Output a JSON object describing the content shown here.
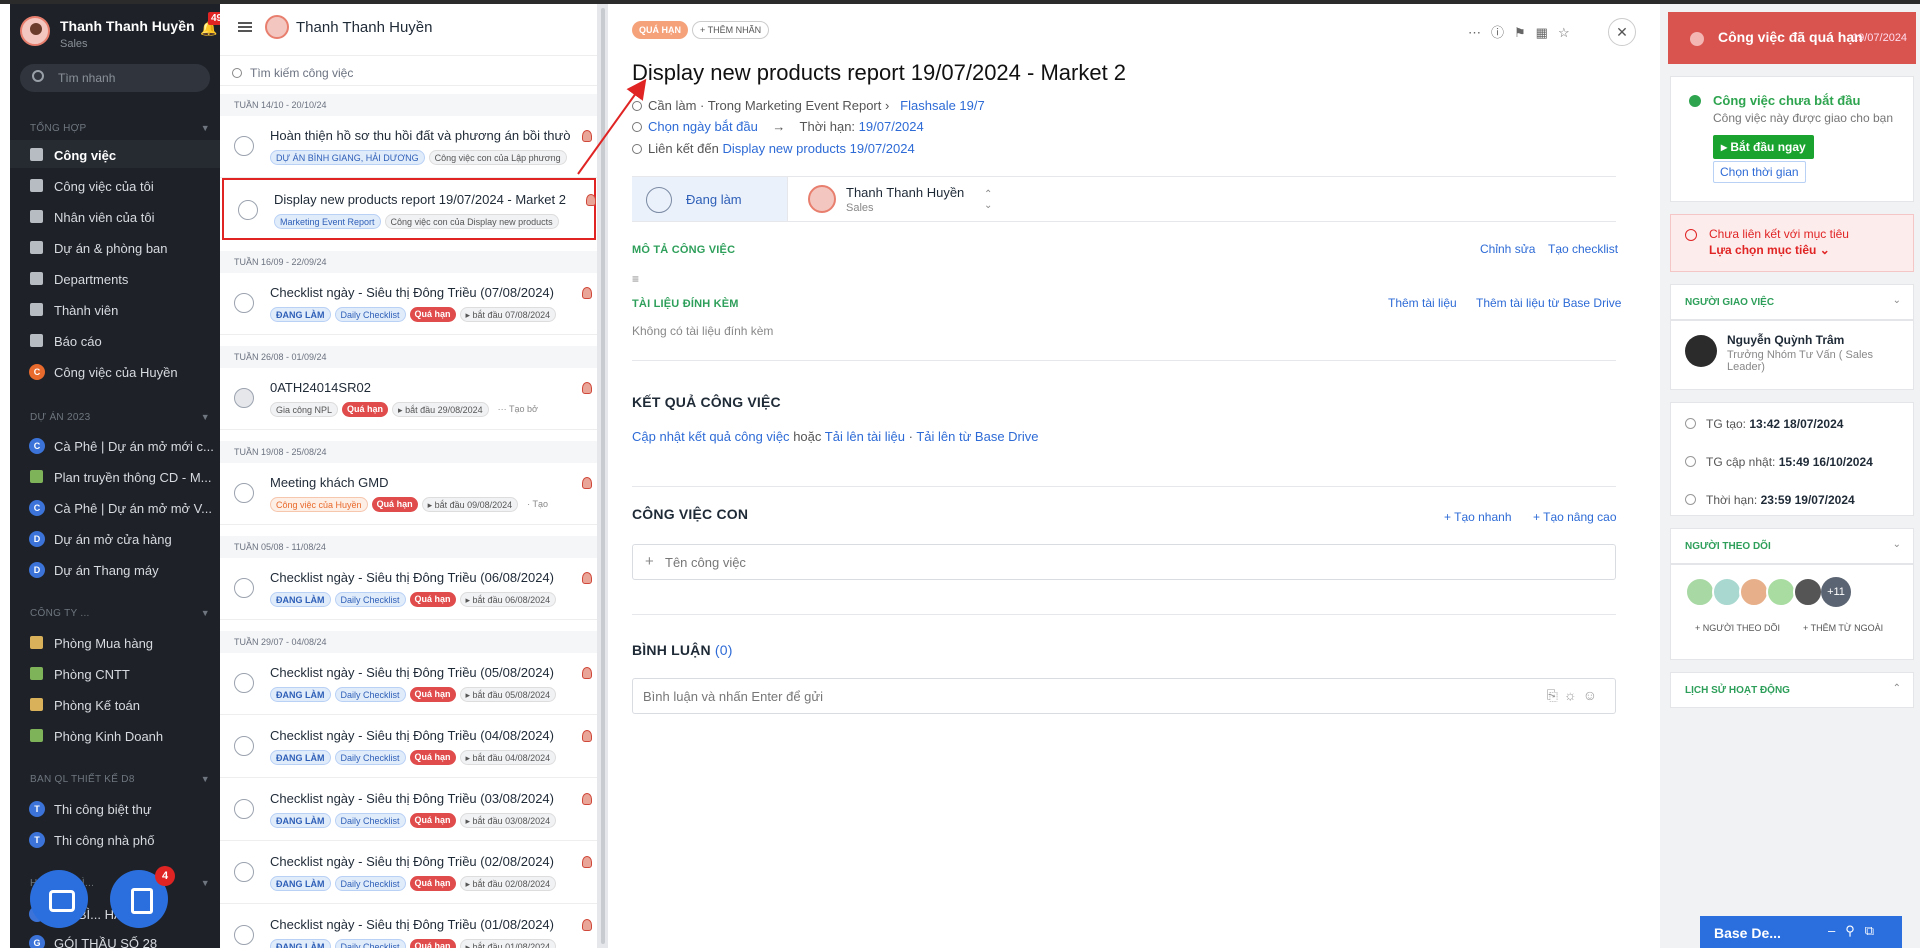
{
  "sidebar": {
    "user_name": "Thanh Thanh Huyền",
    "user_role": "Sales",
    "notif_count": "49",
    "search_placeholder": "Tìm nhanh",
    "sec1": "TỔNG HỢP",
    "items1": [
      "Công việc",
      "Công việc của tôi",
      "Nhân viên của tôi",
      "Dự án & phòng ban",
      "Departments",
      "Thành viên",
      "Báo cáo",
      "Công việc của Huyền"
    ],
    "item_huyen_letter": "C",
    "sec2": "DỰ ÁN 2023",
    "items2": [
      {
        "letter": "C",
        "label": "Cà Phê | Dự án mở mới c..."
      },
      {
        "letter": "",
        "label": "Plan truyền thông CD - M..."
      },
      {
        "letter": "C",
        "label": "Cà Phê | Dự án mở mở V..."
      },
      {
        "letter": "D",
        "label": "Dự án mở cửa hàng"
      },
      {
        "letter": "D",
        "label": "Dự án Thang máy"
      }
    ],
    "sec3": "CÔNG TY ...",
    "items3": [
      "Phòng Mua hàng",
      "Phòng CNTT",
      "Phòng Kế toán",
      "Phòng Kinh Doanh"
    ],
    "sec4": "BAN QL THIẾT KẾ D8",
    "items4": [
      {
        "letter": "T",
        "label": "Thi công biệt thự"
      },
      {
        "letter": "T",
        "label": "Thi công nhà phố"
      }
    ],
    "sec5": "H... HOA BÌ...",
    "items5": [
      {
        "letter": "",
        "label": "...N BÌ... HẢI ..."
      },
      {
        "letter": "G",
        "label": "GÓI THẦU SỐ 28"
      }
    ],
    "fab_badge": "4"
  },
  "list": {
    "header_name": "Thanh Thanh Huyền",
    "search_placeholder": "Tìm kiếm công việc",
    "weeks": [
      "TUẦN 14/10 - 20/10/24",
      "TUẦN 16/09 - 22/09/24",
      "TUẦN 26/08 - 01/09/24",
      "TUẦN 19/08 - 25/08/24",
      "TUẦN 05/08 - 11/08/24",
      "TUẦN 29/07 - 04/08/24"
    ],
    "tasks": [
      {
        "title": "Hoàn thiện hồ sơ thu hồi đất và phương án bồi thườ",
        "tags": [
          [
            "blue",
            "DỰ ÁN BÌNH GIANG, HẢI DƯƠNG"
          ],
          [
            "gray",
            "Công việc con của Lập phương"
          ]
        ]
      },
      {
        "title": "Display new products report 19/07/2024 - Market 2",
        "tags": [
          [
            "blue",
            "Marketing Event Report"
          ],
          [
            "gray",
            "Công việc con của Display new products"
          ]
        ]
      },
      {
        "title": "Checklist ngày - Siêu thị Đông Triều (07/08/2024)",
        "tags": [
          [
            "blue bold",
            "ĐANG LÀM"
          ],
          [
            "blue",
            "Daily Checklist"
          ],
          [
            "red",
            "Quá hạn"
          ],
          [
            "gray",
            "▸ bắt đầu 07/08/2024"
          ]
        ]
      },
      {
        "title": "0ATH24014SR02",
        "tags": [
          [
            "gray",
            "Gia công NPL"
          ],
          [
            "red",
            "Quá hạn"
          ],
          [
            "gray",
            "▸ bắt đầu 29/08/2024"
          ],
          [
            "plain",
            "··· Tạo bở"
          ]
        ]
      },
      {
        "title": "Meeting khách GMD",
        "tags": [
          [
            "orange",
            "Công việc của Huyền"
          ],
          [
            "red",
            "Quá hạn"
          ],
          [
            "gray",
            "▸ bắt đầu 09/08/2024"
          ],
          [
            "plain",
            "· Tạo"
          ]
        ]
      },
      {
        "title": "Checklist ngày - Siêu thị Đông Triều (06/08/2024)",
        "tags": [
          [
            "blue bold",
            "ĐANG LÀM"
          ],
          [
            "blue",
            "Daily Checklist"
          ],
          [
            "red",
            "Quá hạn"
          ],
          [
            "gray",
            "▸ bắt đầu 06/08/2024"
          ]
        ]
      },
      {
        "title": "Checklist ngày - Siêu thị Đông Triều (05/08/2024)",
        "tags": [
          [
            "blue bold",
            "ĐANG LÀM"
          ],
          [
            "blue",
            "Daily Checklist"
          ],
          [
            "red",
            "Quá hạn"
          ],
          [
            "gray",
            "▸ bắt đầu 05/08/2024"
          ]
        ]
      },
      {
        "title": "Checklist ngày - Siêu thị Đông Triều (04/08/2024)",
        "tags": [
          [
            "blue bold",
            "ĐANG LÀM"
          ],
          [
            "blue",
            "Daily Checklist"
          ],
          [
            "red",
            "Quá hạn"
          ],
          [
            "gray",
            "▸ bắt đầu 04/08/2024"
          ]
        ]
      },
      {
        "title": "Checklist ngày - Siêu thị Đông Triều (03/08/2024)",
        "tags": [
          [
            "blue bold",
            "ĐANG LÀM"
          ],
          [
            "blue",
            "Daily Checklist"
          ],
          [
            "red",
            "Quá hạn"
          ],
          [
            "gray",
            "▸ bắt đầu 03/08/2024"
          ]
        ]
      },
      {
        "title": "Checklist ngày - Siêu thị Đông Triều (02/08/2024)",
        "tags": [
          [
            "blue bold",
            "ĐANG LÀM"
          ],
          [
            "blue",
            "Daily Checklist"
          ],
          [
            "red",
            "Quá hạn"
          ],
          [
            "gray",
            "▸ bắt đầu 02/08/2024"
          ]
        ]
      },
      {
        "title": "Checklist ngày - Siêu thị Đông Triều (01/08/2024)",
        "tags": [
          [
            "blue bold",
            "ĐANG LÀM"
          ],
          [
            "blue",
            "Daily Checklist"
          ],
          [
            "red",
            "Quá hạn"
          ],
          [
            "gray",
            "▸ bắt đầu 01/08/2024"
          ]
        ]
      }
    ]
  },
  "detail": {
    "badge": "QUÁ HẠN",
    "add_label": "+ THÊM NHÃN",
    "title": "Display new products report 19/07/2024 - Market 2",
    "meta1_prefix": "Cần làm · Trong Marketing Event Report ›",
    "meta1_link": "Flashsale 19/7",
    "meta2_start": "Chọn ngày bắt đầu",
    "meta2_arrow": "→",
    "meta2_deadline_label": "Thời hạn:",
    "meta2_deadline": "19/07/2024",
    "meta3_label": "Liên kết đến",
    "meta3_link": "Display new products 19/07/2024",
    "status": "Đang làm",
    "assignee_name": "Thanh Thanh Huyền",
    "assignee_role": "Sales",
    "desc_heading": "MÔ TẢ CÔNG VIỆC",
    "desc_edit": "Chỉnh sửa",
    "desc_checklist": "Tạo checklist",
    "attach_heading": "TÀI LIỆU ĐÍNH KÈM",
    "attach_add": "Thêm tài liệu",
    "attach_drive": "Thêm tài liệu từ Base Drive",
    "attach_empty": "Không có tài liệu đính kèm",
    "result_heading": "KẾT QUẢ CÔNG VIỆC",
    "result_update": "Cập nhật kết quả công việc",
    "result_or": "hoặc",
    "result_upload": "Tải lên tài liệu",
    "result_sep": "·",
    "result_drive": "Tải lên từ Base Drive",
    "sub_heading": "CÔNG VIỆC CON",
    "sub_quick": "+ Tạo nhanh",
    "sub_adv": "+ Tạo nâng cao",
    "sub_placeholder": "Tên công việc",
    "comment_heading": "BÌNH LUẬN",
    "comment_count": "(0)",
    "comment_placeholder": "Bình luận và nhấn Enter để gửi"
  },
  "right": {
    "overdue": "Công việc đã quá hạn",
    "overdue_date": "19/07/2024",
    "not_started": "Công việc chưa bắt đầu",
    "not_started_sub": "Công việc này được giao cho bạn",
    "start_now": "▸ Bắt đầu ngay",
    "pick_time": "Chọn thời gian",
    "unlinked": "Chưa liên kết với mục tiêu",
    "pick_goal": "Lựa chọn mục tiêu ⌄",
    "assigner_heading": "NGƯỜI GIAO VIỆC",
    "assigner_name": "Nguyễn Quỳnh Trâm",
    "assigner_role": "Trưởng Nhóm Tư Vấn ( Sales Leader)",
    "created_label": "TG tạo:",
    "created": "13:42 18/07/2024",
    "updated_label": "TG cập nhật:",
    "updated": "15:49 16/10/2024",
    "deadline_label": "Thời hạn:",
    "deadline": "23:59 19/07/2024",
    "followers_heading": "NGƯỜI THEO DÕI",
    "followers_more": "+11",
    "add_follower": "+ NGƯỜI THEO DÕI",
    "add_external": "+ THÊM TỪ NGOÀI",
    "history_heading": "LỊCH SỬ HOẠT ĐỘNG"
  },
  "basedesk": {
    "title": "Base De..."
  },
  "colors": {
    "accent": "#2b6fde",
    "overdue": "#d9534f",
    "green": "#2e9f5a"
  }
}
